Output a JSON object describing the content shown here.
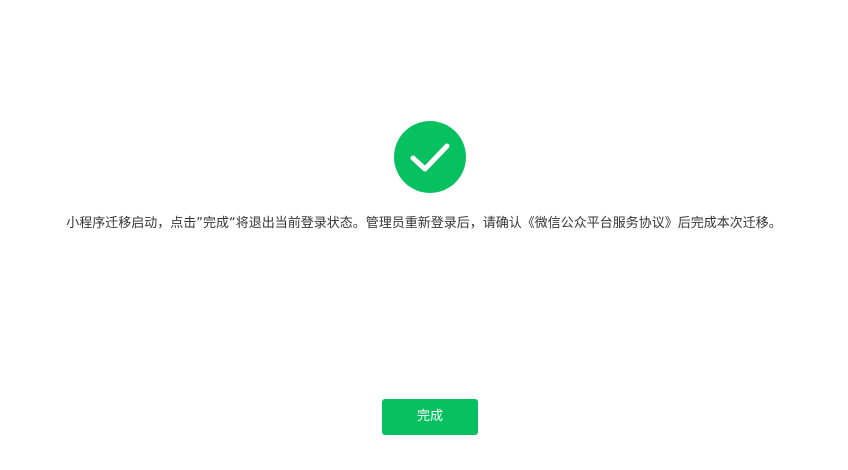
{
  "status": {
    "icon": "check-circle-icon",
    "icon_color": "#07c160"
  },
  "message": "小程序迁移启动，点击”完成“将退出当前登录状态。管理员重新登录后，请确认《微信公众平台服务协议》后完成本次迁移。",
  "actions": {
    "done_label": "完成",
    "done_color": "#07c160"
  }
}
